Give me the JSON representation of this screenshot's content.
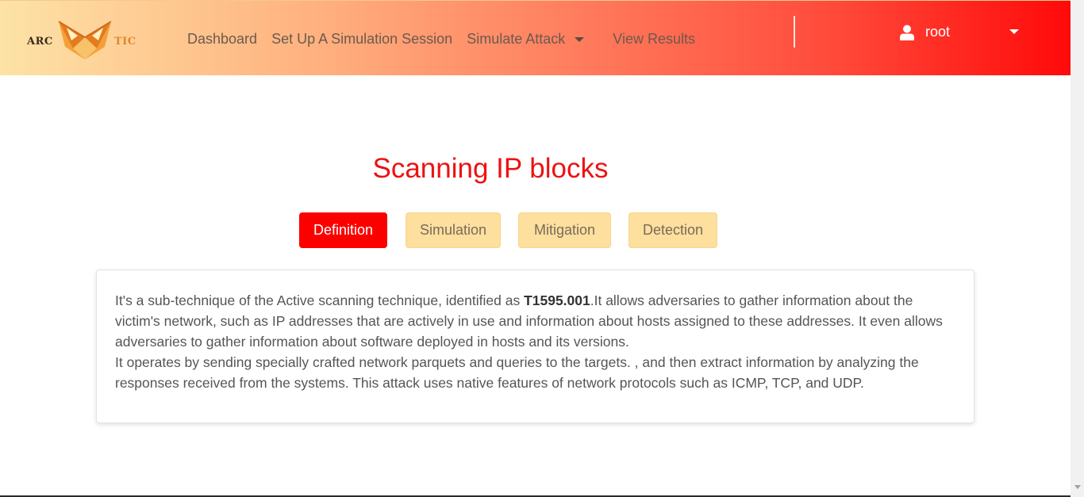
{
  "logo": {
    "left_text": "ARC",
    "right_text": "TIC"
  },
  "nav": {
    "links": [
      "Dashboard",
      "Set Up A Simulation Session",
      "Simulate Attack",
      "View Results"
    ]
  },
  "user": {
    "name": "root",
    "icon": "user-icon"
  },
  "page": {
    "title": "Scanning IP blocks"
  },
  "tabs": [
    {
      "label": "Definition",
      "active": true
    },
    {
      "label": "Simulation",
      "active": false
    },
    {
      "label": "Mitigation",
      "active": false
    },
    {
      "label": "Detection",
      "active": false
    }
  ],
  "definition": {
    "p1_before": "It's a sub-technique of the Active scanning technique, identified as ",
    "p1_id": "T1595.001",
    "p1_after": ".It allows adversaries to gather information about the victim's network, such as IP addresses that are actively in use and information about hosts assigned to these addresses. It even allows adversaries to gather information about software deployed in hosts and its versions.",
    "p2": "It operates by sending specially crafted network parquets and queries to the targets. , and then extract information by analyzing the responses received from the systems. This attack uses native features of network protocols such as ICMP, TCP, and UDP."
  },
  "colors": {
    "accent_red": "#fc0000",
    "tab_inactive": "#fddf9e",
    "title_red": "#ee1111"
  }
}
